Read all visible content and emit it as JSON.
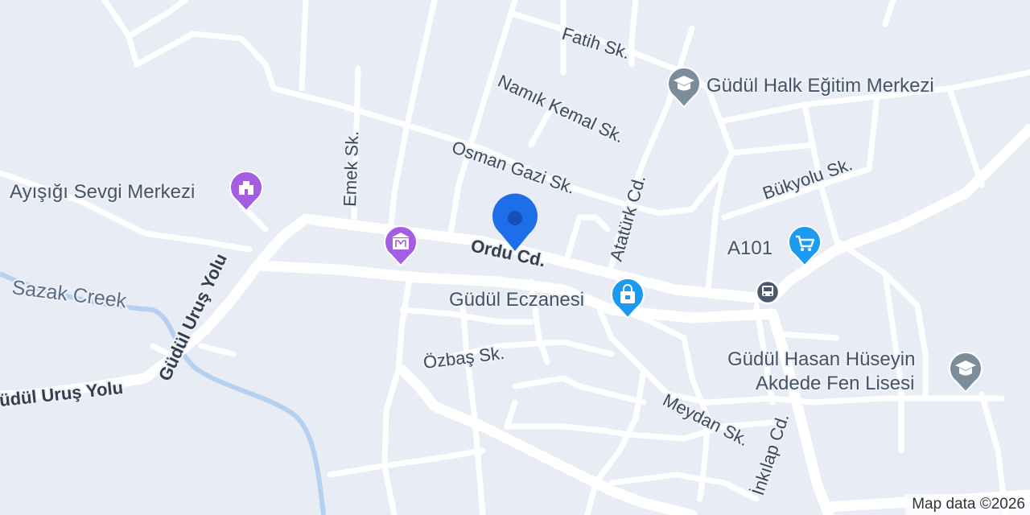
{
  "map": {
    "attribution": "Map data ©2026",
    "colors": {
      "background": "#e8ecf5",
      "road": "#ffffff",
      "water": "#b6d1f0",
      "poi_school": "#7b8c9b",
      "poi_culture": "#a45ee3",
      "poi_shopping": "#1a9bf0",
      "location_pin": "#1c6fe8"
    },
    "streets": [
      {
        "id": "fatih",
        "label": "Fatih Sk."
      },
      {
        "id": "namik-kemal",
        "label": "Namık Kemal Sk."
      },
      {
        "id": "osman-gazi",
        "label": "Osman Gazi Sk."
      },
      {
        "id": "emek",
        "label": "Emek Sk."
      },
      {
        "id": "ataturk",
        "label": "Atatürk Cd."
      },
      {
        "id": "bukyolu",
        "label": "Bükyolu Sk."
      },
      {
        "id": "ordu",
        "label": "Ordu Cd."
      },
      {
        "id": "gudul-urus-1",
        "label": "Güdül Uruş Yolu"
      },
      {
        "id": "gudul-urus-2",
        "label": "üdül Uruş Yolu"
      },
      {
        "id": "ozbas",
        "label": "Özbaş Sk."
      },
      {
        "id": "meydan",
        "label": "Meydan Sk."
      },
      {
        "id": "inkilap",
        "label": "İnkılap Cd."
      }
    ],
    "water": {
      "label": "Sazak Creek"
    },
    "pois": [
      {
        "id": "halk-egitim",
        "lines": [
          "Güdül Halk Eğitim Merkezi"
        ],
        "icon": "graduation-cap-icon",
        "category": "school"
      },
      {
        "id": "ayisigi",
        "lines": [
          "Ayışığı Sevgi Merkezi"
        ],
        "icon": "monument-icon",
        "category": "culture"
      },
      {
        "id": "museum",
        "lines": [],
        "icon": "museum-icon",
        "category": "culture"
      },
      {
        "id": "a101",
        "lines": [
          "A101"
        ],
        "icon": "shopping-cart-icon",
        "category": "shopping"
      },
      {
        "id": "eczane",
        "lines": [
          "Güdül Eczanesi"
        ],
        "icon": "shopping-bag-icon",
        "category": "shopping"
      },
      {
        "id": "lise",
        "lines": [
          "Güdül Hasan Hüseyin",
          "Akdede Fen Lisesi"
        ],
        "icon": "graduation-cap-icon",
        "category": "school"
      },
      {
        "id": "bus",
        "lines": [],
        "icon": "bus-stop-icon",
        "category": "transit"
      }
    ]
  }
}
